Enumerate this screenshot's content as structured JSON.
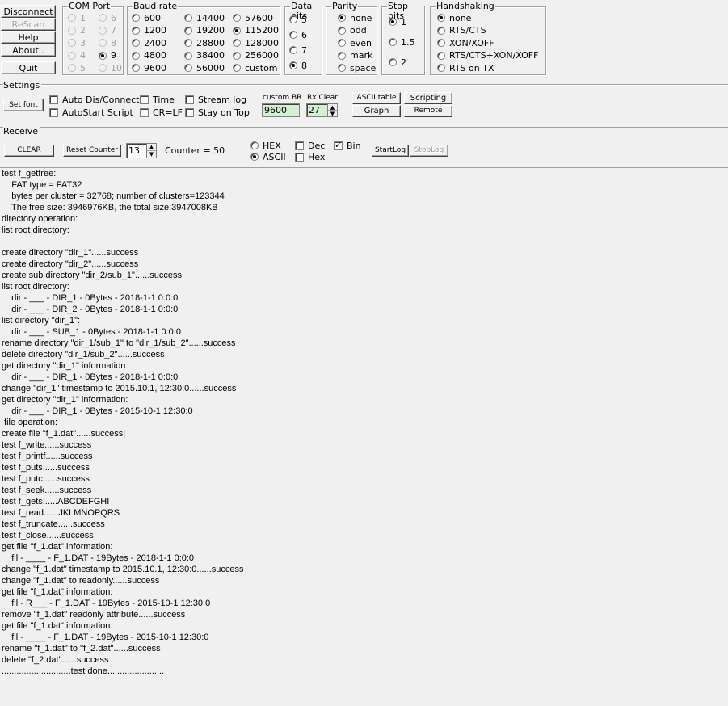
{
  "left_buttons": {
    "disconnect": "Disconnect",
    "rescan": "ReScan",
    "help": "Help",
    "about": "About..",
    "quit": "Quit"
  },
  "com_port": {
    "title": "COM Port",
    "items": [
      "1",
      "2",
      "3",
      "4",
      "5",
      "6",
      "7",
      "8",
      "9",
      "10"
    ],
    "selected": "9"
  },
  "baud_rate": {
    "title": "Baud rate",
    "items": [
      "600",
      "1200",
      "2400",
      "4800",
      "9600",
      "14400",
      "19200",
      "28800",
      "38400",
      "56000",
      "57600",
      "115200",
      "128000",
      "256000",
      "custom"
    ],
    "selected": "115200"
  },
  "data_bits": {
    "title": "Data bits",
    "items": [
      "5",
      "6",
      "7",
      "8"
    ],
    "selected": "8"
  },
  "parity": {
    "title": "Parity",
    "items": [
      "none",
      "odd",
      "even",
      "mark",
      "space"
    ],
    "selected": "none"
  },
  "stop_bits": {
    "title": "Stop bits",
    "items": [
      "1",
      "1.5",
      "2"
    ],
    "selected": "1"
  },
  "handshaking": {
    "title": "Handshaking",
    "items": [
      "none",
      "RTS/CTS",
      "XON/XOFF",
      "RTS/CTS+XON/XOFF",
      "RTS on TX"
    ],
    "selected": "none"
  },
  "settings": {
    "title": "Settings",
    "set_font": "Set font",
    "auto_dis_connect": "Auto Dis/Connect",
    "autostart_script": "AutoStart Script",
    "time": "Time",
    "cr_lf": "CR=LF",
    "stream_log": "Stream log",
    "stay_on_top": "Stay on Top",
    "custom_br_label": "custom BR",
    "custom_br_value": "9600",
    "rx_clear_label": "Rx Clear",
    "rx_clear_value": "27",
    "ascii_table": "ASCII table",
    "graph": "Graph",
    "scripting": "Scripting",
    "remote": "Remote"
  },
  "receive": {
    "title": "Receive",
    "clear": "CLEAR",
    "reset_counter": "Reset Counter",
    "counter_spin_value": "13",
    "counter_label": "Counter =",
    "counter_value": "50",
    "hex": "HEX",
    "ascii": "ASCII",
    "dec": "Dec",
    "hex_chk": "Hex",
    "bin": "Bin",
    "start_log": "StartLog",
    "stop_log": "StopLog"
  },
  "log_lines": [
    "test f_getfree:",
    "    FAT type = FAT32",
    "    bytes per cluster = 32768; number of clusters=123344",
    "    The free size: 3946976KB, the total size:3947008KB",
    "directory operation:",
    "list root directory:",
    "",
    "create directory \"dir_1\"......success",
    "create directory \"dir_2\"......success",
    "create sub directory \"dir_2/sub_1\"......success",
    "list root directory:",
    "    dir - ___ - DIR_1 - 0Bytes - 2018-1-1 0:0:0",
    "    dir - ___ - DIR_2 - 0Bytes - 2018-1-1 0:0:0",
    "list directory \"dir_1\":",
    "    dir - ___ - SUB_1 - 0Bytes - 2018-1-1 0:0:0",
    "rename directory \"dir_1/sub_1\" to \"dir_1/sub_2\"......success",
    "delete directory \"dir_1/sub_2\"......success",
    "get directory \"dir_1\" information:",
    "    dir - ___ - DIR_1 - 0Bytes - 2018-1-1 0:0:0",
    "change \"dir_1\" timestamp to 2015.10.1, 12:30:0......success",
    "get directory \"dir_1\" information:",
    "    dir - ___ - DIR_1 - 0Bytes - 2015-10-1 12:30:0",
    " file operation:",
    "create file \"f_1.dat\"......success|",
    "test f_write......success",
    "test f_printf......success",
    "test f_puts......success",
    "test f_putc......success",
    "test f_seek......success",
    "test f_gets......ABCDEFGHI",
    "test f_read......JKLMNOPQRS",
    "test f_truncate......success",
    "test f_close......success",
    "get file \"f_1.dat\" information:",
    "    fil - ____ - F_1.DAT - 19Bytes - 2018-1-1 0:0:0",
    "change \"f_1.dat\" timestamp to 2015.10.1, 12:30:0......success",
    "change \"f_1.dat\" to readonly......success",
    "get file \"f_1.dat\" information:",
    "    fil - R___ - F_1.DAT - 19Bytes - 2015-10-1 12:30:0",
    "remove \"f_1.dat\" readonly attribute......success",
    "get file \"f_1.dat\" information:",
    "    fil - ____ - F_1.DAT - 19Bytes - 2015-10-1 12:30:0",
    "rename \"f_1.dat\" to \"f_2.dat\"......success",
    "delete \"f_2.dat\"......success",
    "............................test done......................."
  ]
}
